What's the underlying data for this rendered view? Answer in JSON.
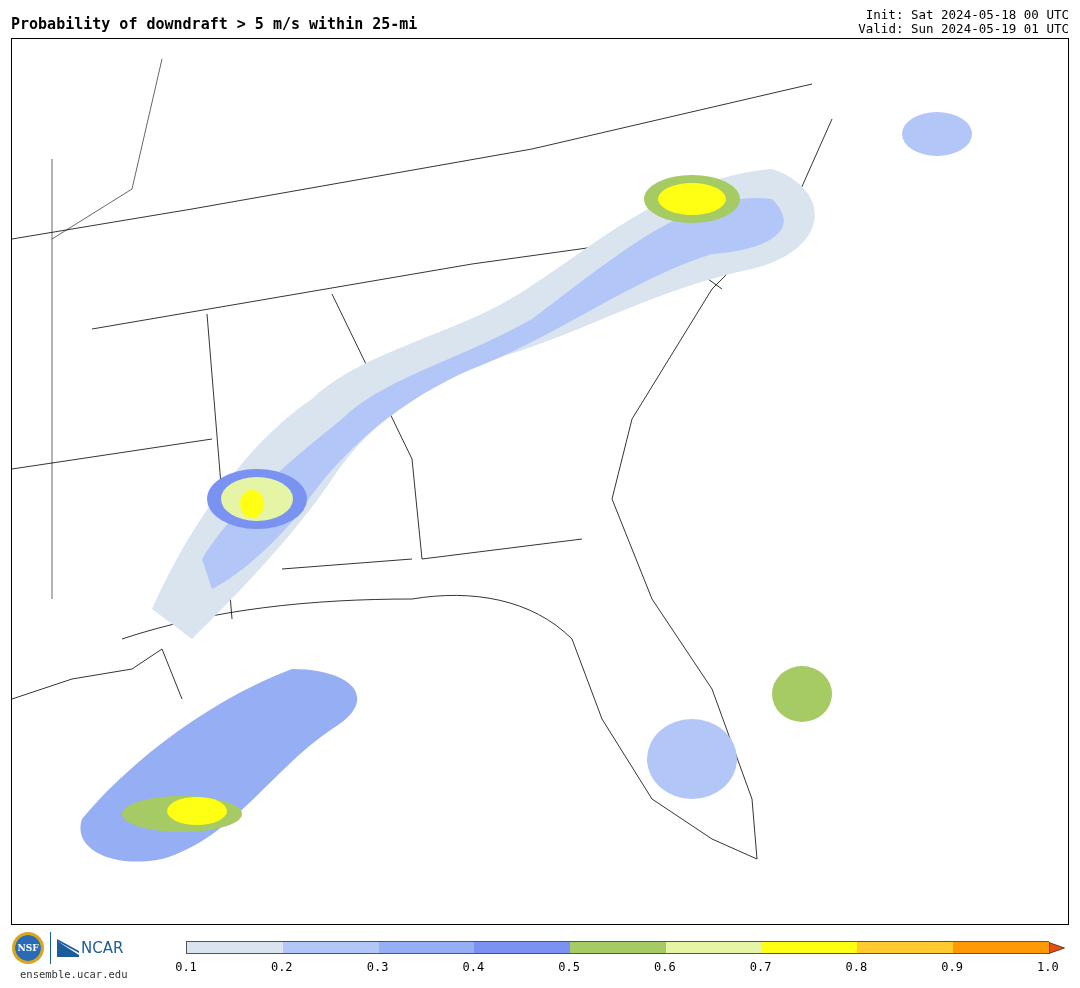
{
  "title": "Probability of downdraft > 5 m/s within 25-mi",
  "init": "Init: Sat 2024-05-18 00 UTC",
  "valid": "Valid: Sun 2024-05-19 01 UTC",
  "logos": {
    "nsf": "NSF",
    "ncar": "NCAR",
    "site": "ensemble.ucar.edu"
  },
  "colorbar": {
    "bins": [
      {
        "color": "#d9e4ef"
      },
      {
        "color": "#b3c6f8"
      },
      {
        "color": "#95aef4"
      },
      {
        "color": "#7a92f1"
      },
      {
        "color": "#a6ca64"
      },
      {
        "color": "#e6f4a6"
      },
      {
        "color": "#ffff14"
      },
      {
        "color": "#ffcb2e"
      },
      {
        "color": "#ff9a05"
      }
    ],
    "extend_arrow": {
      "color": "#e84e0f"
    },
    "ticks": [
      "0.1",
      "0.2",
      "0.3",
      "0.4",
      "0.5",
      "0.6",
      "0.7",
      "0.8",
      "0.9",
      "1.0"
    ]
  }
}
